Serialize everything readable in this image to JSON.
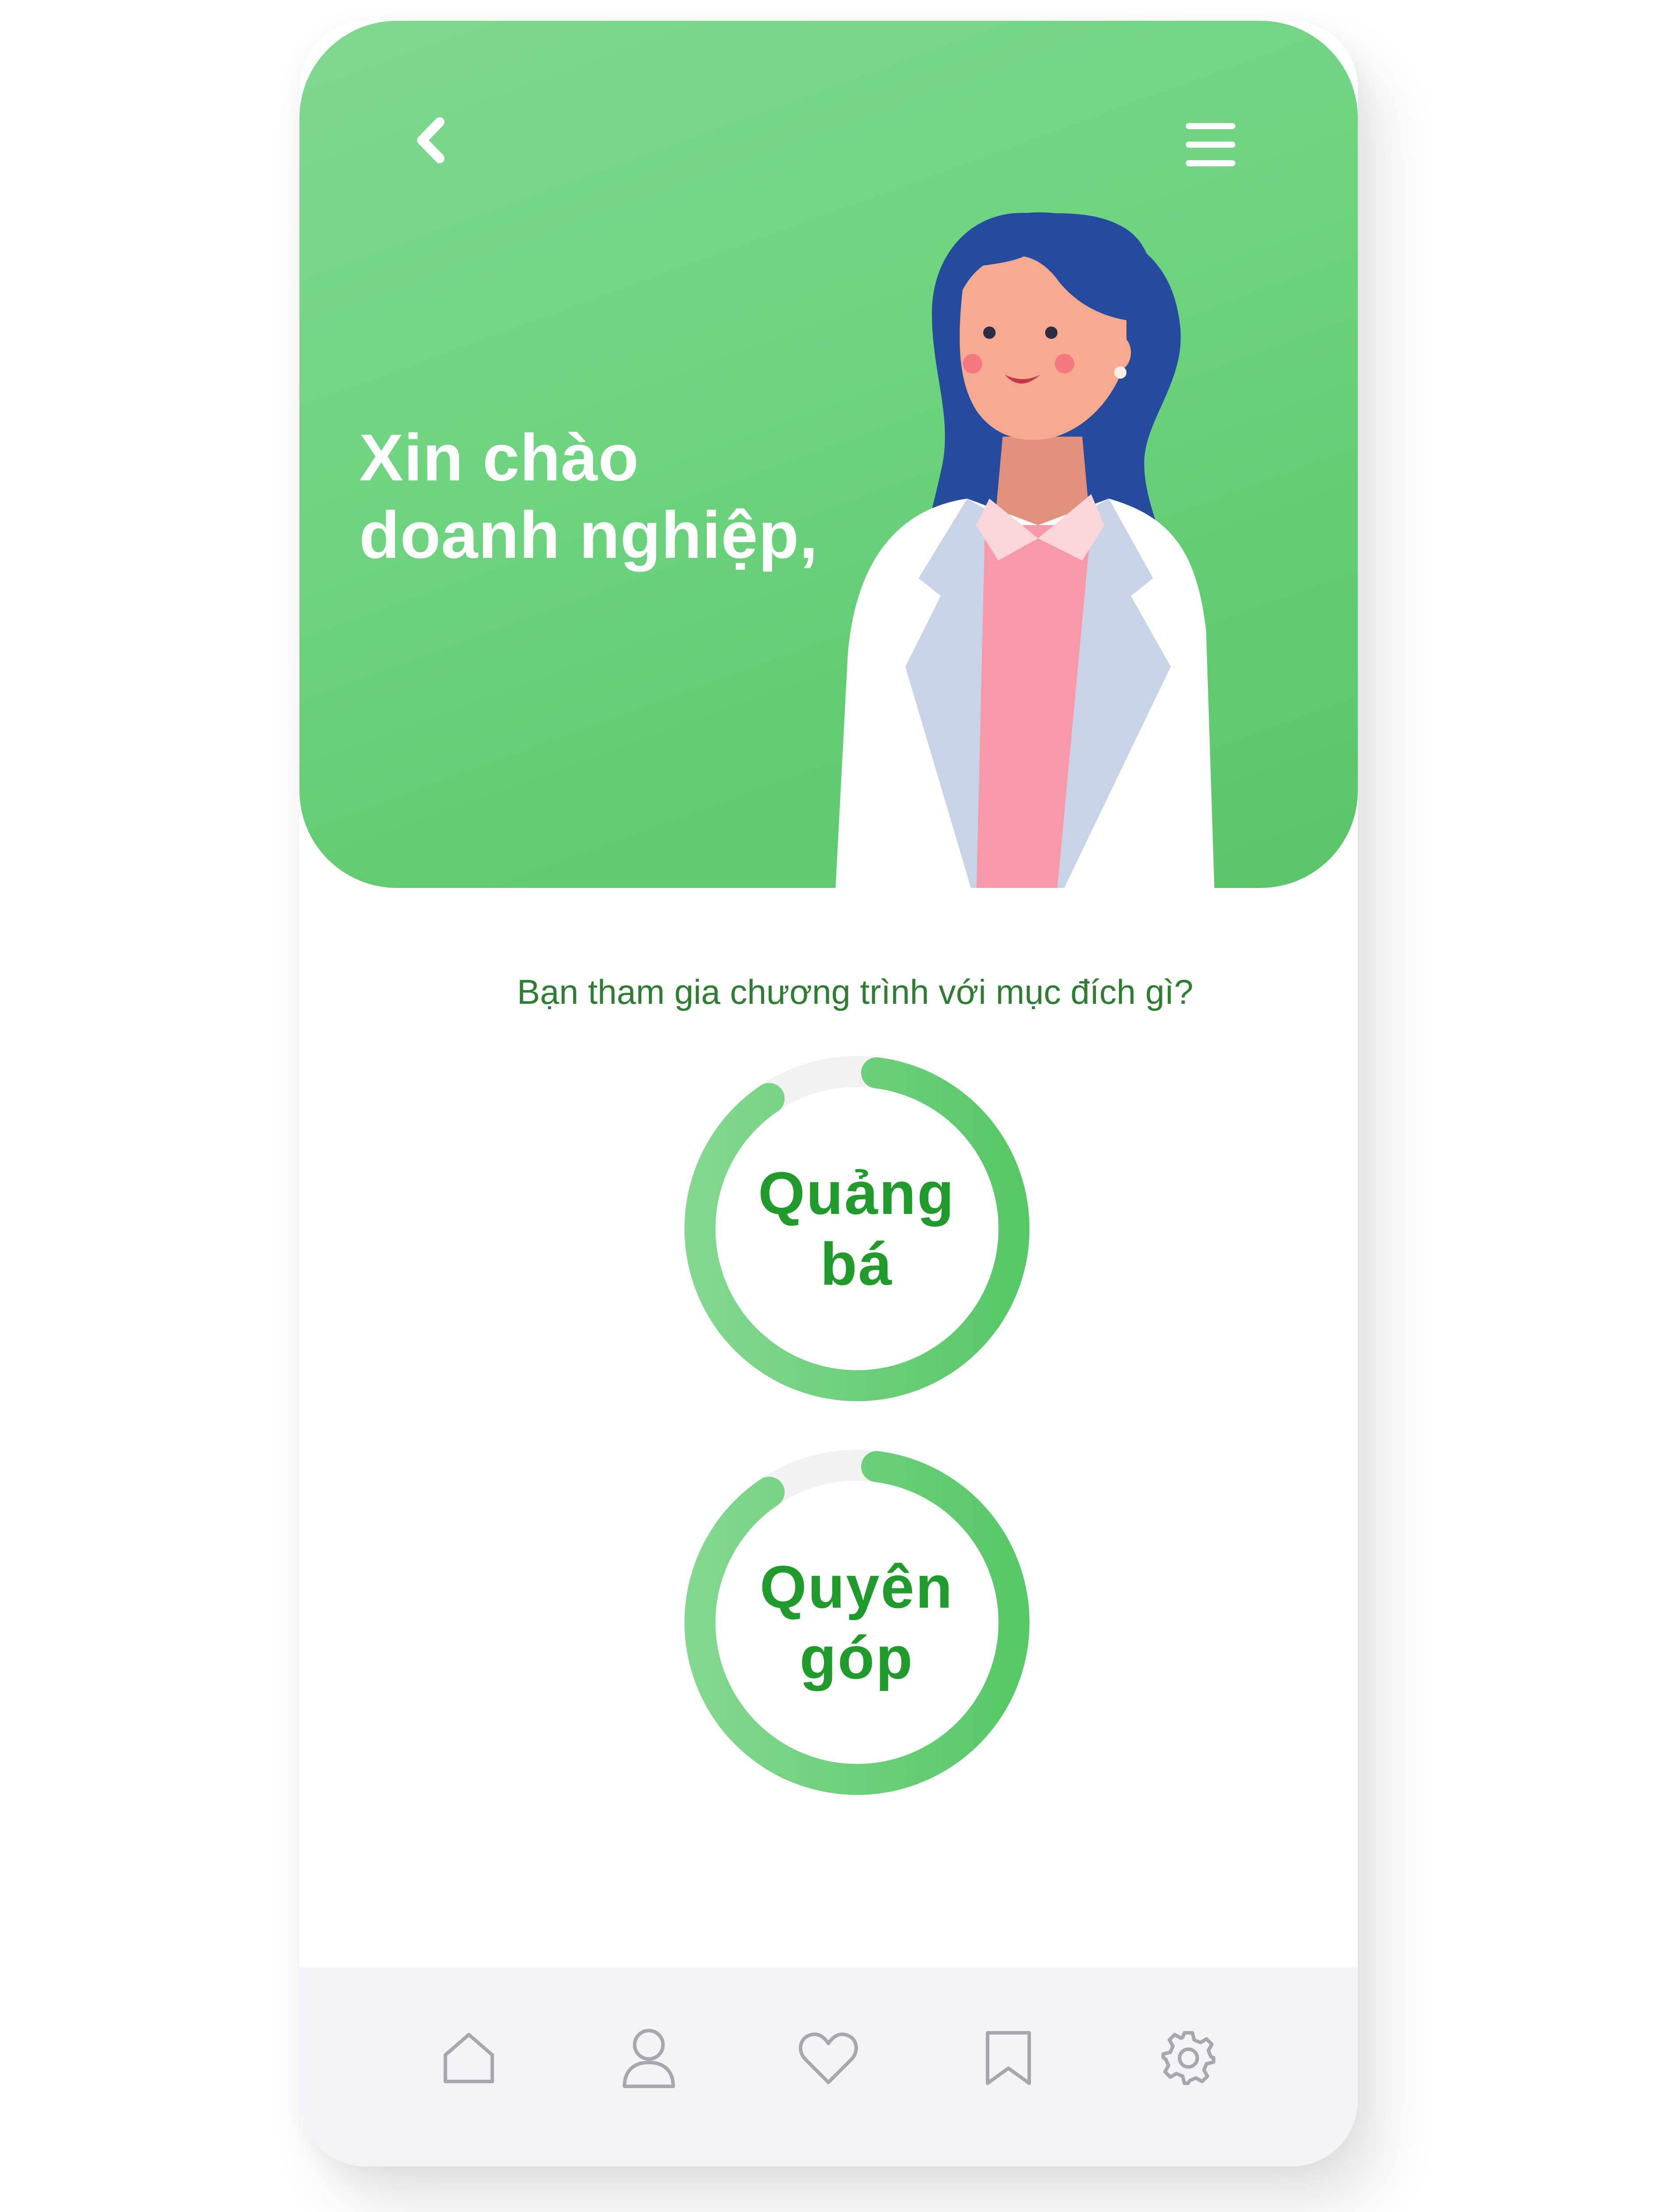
{
  "header": {
    "back_icon": "chevron-left-icon",
    "menu_icon": "hamburger-menu-icon",
    "greeting_line1": "Xin chào",
    "greeting_line2": "doanh nghiệp,"
  },
  "main": {
    "question": "Bạn tham gia chương trình với mục đích gì?",
    "options": [
      {
        "label_line1": "Quảng",
        "label_line2": "bá"
      },
      {
        "label_line1": "Quyên",
        "label_line2": "góp"
      }
    ]
  },
  "tabbar": {
    "items": [
      {
        "icon": "home-icon"
      },
      {
        "icon": "user-icon"
      },
      {
        "icon": "heart-icon"
      },
      {
        "icon": "bookmark-icon"
      },
      {
        "icon": "gear-icon"
      }
    ]
  },
  "colors": {
    "brand_green": "#6dd37e",
    "text_green": "#1f9a2b",
    "tabbar_bg": "#f3f3f8",
    "icon_gray": "#a7a7ad"
  }
}
